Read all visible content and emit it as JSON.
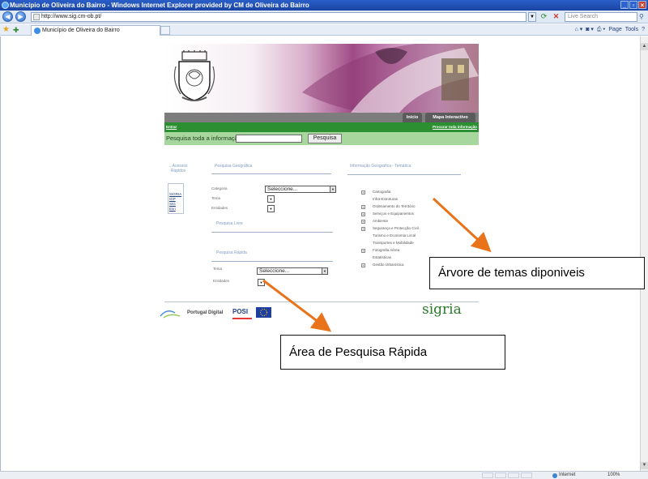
{
  "window": {
    "title": "Município de Oliveira do Bairro - Windows Internet Explorer provided by CM de Oliveira do Bairro",
    "address_url": "http://www.sig.cm-ob.pt/",
    "search_placeholder": "Live Search",
    "tab_title": "Município de Oliveira do Bairro",
    "command_items": [
      "Page",
      "Tools"
    ],
    "status_zone": "Internet",
    "status_zoom": "100%"
  },
  "site": {
    "nav_tabs": [
      "Início",
      "Mapa Interactivo"
    ],
    "login_link": "Entrar",
    "search_all_link": "Procurar toda informação",
    "search_label": "Pesquisa toda a informação:",
    "search_button": "Pesquisa",
    "left_column": {
      "title": "...Acessos Rápidos",
      "links": [
        "SIGRIA",
        "IGP",
        "SIG",
        "Esri"
      ]
    },
    "geo_search": {
      "title": "Pesquisa Geográfica",
      "fields": [
        "Categoria",
        "Tema",
        "Entidades"
      ],
      "category_select": "Seleccione...",
      "simple_title": "Pesquisa Livre"
    },
    "quick_search": {
      "title": "Pesquisa Rápida",
      "fields": [
        "Tema",
        "Entidades"
      ],
      "theme_select": "Seleccione..."
    },
    "thematic": {
      "title": "Informação Geográfica - Temática",
      "items": [
        {
          "label": "Cartografia",
          "expander": "+"
        },
        {
          "label": "Infra-Estruturas",
          "expander": ""
        },
        {
          "label": "Ordenamento do Território",
          "expander": "+"
        },
        {
          "label": "Serviços e Equipamentos",
          "expander": "+"
        },
        {
          "label": "Ambiente",
          "expander": "+"
        },
        {
          "label": "Segurança e Protecção Civil",
          "expander": "+"
        },
        {
          "label": "Turismo e Economia Local",
          "expander": ""
        },
        {
          "label": "Transportes e Mobilidade",
          "expander": ""
        },
        {
          "label": "Fotografia Aérea",
          "expander": "+"
        },
        {
          "label": "Estatísticas",
          "expander": ""
        },
        {
          "label": "Gestão Urbanística",
          "expander": "+"
        }
      ]
    },
    "footer": {
      "portugal_logo": "Portugal Digital",
      "poc_logo": "POSI",
      "sigria_logo": "sigria"
    }
  },
  "annotations": {
    "tree_callout": "Árvore de temas diponiveis",
    "quick_callout": "Área de Pesquisa Rápida",
    "arrow_color": "#e8731a"
  }
}
